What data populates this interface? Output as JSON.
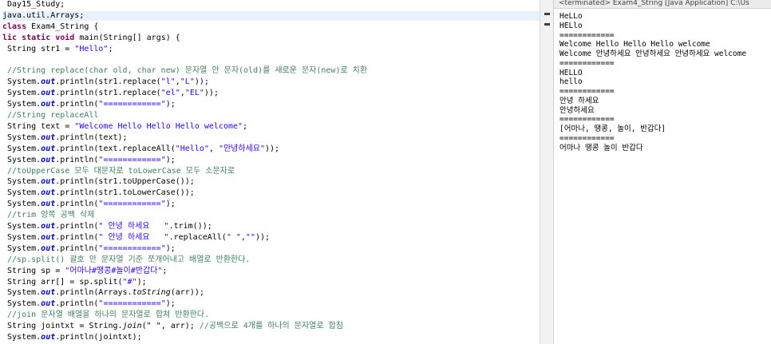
{
  "editor": {
    "lines": [
      {
        "tokens": [
          {
            "t": " Day15_Study;",
            "c": ""
          }
        ]
      },
      {
        "hl": true,
        "tokens": [
          {
            "t": "java.util.Arrays;",
            "c": ""
          }
        ]
      },
      {
        "tokens": [
          {
            "t": "class",
            "c": "k"
          },
          {
            "t": " Exam4_String {",
            "c": ""
          }
        ]
      },
      {
        "tokens": [
          {
            "t": "lic",
            "c": "k"
          },
          {
            "t": " ",
            "c": ""
          },
          {
            "t": "static",
            "c": "k"
          },
          {
            "t": " ",
            "c": ""
          },
          {
            "t": "void",
            "c": "k"
          },
          {
            "t": " main(String[] args) {",
            "c": ""
          }
        ]
      },
      {
        "tokens": [
          {
            "t": " String str1 = ",
            "c": ""
          },
          {
            "t": "\"Hello\"",
            "c": "s"
          },
          {
            "t": ";",
            "c": ""
          }
        ]
      },
      {
        "tokens": [
          {
            "t": "",
            "c": ""
          }
        ]
      },
      {
        "tokens": [
          {
            "t": " //String replace(char old, char new) 문자열 안 문자(old)를 새로운 문자(new)로 치환",
            "c": "c"
          }
        ]
      },
      {
        "tokens": [
          {
            "t": " System.",
            "c": ""
          },
          {
            "t": "out",
            "c": "f"
          },
          {
            "t": ".println(str1.replace(",
            "c": ""
          },
          {
            "t": "\"l\"",
            "c": "s"
          },
          {
            "t": ",",
            "c": ""
          },
          {
            "t": "\"L\"",
            "c": "s"
          },
          {
            "t": "));",
            "c": ""
          }
        ]
      },
      {
        "tokens": [
          {
            "t": " System.",
            "c": ""
          },
          {
            "t": "out",
            "c": "f"
          },
          {
            "t": ".println(str1.replace(",
            "c": ""
          },
          {
            "t": "\"el\"",
            "c": "s"
          },
          {
            "t": ",",
            "c": ""
          },
          {
            "t": "\"EL\"",
            "c": "s"
          },
          {
            "t": "));",
            "c": ""
          }
        ]
      },
      {
        "tokens": [
          {
            "t": " System.",
            "c": ""
          },
          {
            "t": "out",
            "c": "f"
          },
          {
            "t": ".println(",
            "c": ""
          },
          {
            "t": "\"============\"",
            "c": "s"
          },
          {
            "t": ");",
            "c": ""
          }
        ]
      },
      {
        "tokens": [
          {
            "t": " //String replaceAll",
            "c": "c"
          }
        ]
      },
      {
        "tokens": [
          {
            "t": " String text = ",
            "c": ""
          },
          {
            "t": "\"Welcome Hello Hello Hello welcome\"",
            "c": "s"
          },
          {
            "t": ";",
            "c": ""
          }
        ]
      },
      {
        "tokens": [
          {
            "t": " System.",
            "c": ""
          },
          {
            "t": "out",
            "c": "f"
          },
          {
            "t": ".println(text);",
            "c": ""
          }
        ]
      },
      {
        "tokens": [
          {
            "t": " System.",
            "c": ""
          },
          {
            "t": "out",
            "c": "f"
          },
          {
            "t": ".println(text.replaceAll(",
            "c": ""
          },
          {
            "t": "\"Hello\"",
            "c": "s"
          },
          {
            "t": ", ",
            "c": ""
          },
          {
            "t": "\"안녕하세요\"",
            "c": "s"
          },
          {
            "t": "));",
            "c": ""
          }
        ]
      },
      {
        "tokens": [
          {
            "t": " System.",
            "c": ""
          },
          {
            "t": "out",
            "c": "f"
          },
          {
            "t": ".println(",
            "c": ""
          },
          {
            "t": "\"============\"",
            "c": "s"
          },
          {
            "t": ");",
            "c": ""
          }
        ]
      },
      {
        "tokens": [
          {
            "t": " //toUpperCase 모두 대문자로 toLowerCase 모두 소문자로",
            "c": "c"
          }
        ]
      },
      {
        "tokens": [
          {
            "t": " System.",
            "c": ""
          },
          {
            "t": "out",
            "c": "f"
          },
          {
            "t": ".println(str1.toUpperCase());",
            "c": ""
          }
        ]
      },
      {
        "tokens": [
          {
            "t": " System.",
            "c": ""
          },
          {
            "t": "out",
            "c": "f"
          },
          {
            "t": ".println(str1.toLowerCase());",
            "c": ""
          }
        ]
      },
      {
        "tokens": [
          {
            "t": " System.",
            "c": ""
          },
          {
            "t": "out",
            "c": "f"
          },
          {
            "t": ".println(",
            "c": ""
          },
          {
            "t": "\"============\"",
            "c": "s"
          },
          {
            "t": ");",
            "c": ""
          }
        ]
      },
      {
        "tokens": [
          {
            "t": " //trim 양쪽 공백 삭제",
            "c": "c"
          }
        ]
      },
      {
        "tokens": [
          {
            "t": " System.",
            "c": ""
          },
          {
            "t": "out",
            "c": "f"
          },
          {
            "t": ".println(",
            "c": ""
          },
          {
            "t": "\" 안녕 하세요   \"",
            "c": "s"
          },
          {
            "t": ".trim());",
            "c": ""
          }
        ]
      },
      {
        "tokens": [
          {
            "t": " System.",
            "c": ""
          },
          {
            "t": "out",
            "c": "f"
          },
          {
            "t": ".println(",
            "c": ""
          },
          {
            "t": "\" 안녕 하세요   \"",
            "c": "s"
          },
          {
            "t": ".replaceAll(",
            "c": ""
          },
          {
            "t": "\" \"",
            "c": "s"
          },
          {
            "t": ",",
            "c": ""
          },
          {
            "t": "\"\"",
            "c": "s"
          },
          {
            "t": "));",
            "c": ""
          }
        ]
      },
      {
        "tokens": [
          {
            "t": " System.",
            "c": ""
          },
          {
            "t": "out",
            "c": "f"
          },
          {
            "t": ".println(",
            "c": ""
          },
          {
            "t": "\"============\"",
            "c": "s"
          },
          {
            "t": ");",
            "c": ""
          }
        ]
      },
      {
        "tokens": [
          {
            "t": " //sp.split() 괄호 안 문자열 기준 쪼개어내고 배열로 반환한다.",
            "c": "c"
          }
        ]
      },
      {
        "tokens": [
          {
            "t": " String sp = ",
            "c": ""
          },
          {
            "t": "\"어마나#땡콩#놀이#반갑다\"",
            "c": "s"
          },
          {
            "t": ";",
            "c": ""
          }
        ]
      },
      {
        "tokens": [
          {
            "t": " String arr[] = sp.split(",
            "c": ""
          },
          {
            "t": "\"#\"",
            "c": "s"
          },
          {
            "t": ");",
            "c": ""
          }
        ]
      },
      {
        "tokens": [
          {
            "t": " System.",
            "c": ""
          },
          {
            "t": "out",
            "c": "f"
          },
          {
            "t": ".println(Arrays.",
            "c": ""
          },
          {
            "t": "toString",
            "c": "m"
          },
          {
            "t": "(arr));",
            "c": ""
          }
        ]
      },
      {
        "tokens": [
          {
            "t": " System.",
            "c": ""
          },
          {
            "t": "out",
            "c": "f"
          },
          {
            "t": ".println(",
            "c": ""
          },
          {
            "t": "\"============\"",
            "c": "s"
          },
          {
            "t": ");",
            "c": ""
          }
        ]
      },
      {
        "tokens": [
          {
            "t": " //join 문자열 배열을 하나의 문자열로 합쳐 반환한다.",
            "c": "c"
          }
        ]
      },
      {
        "tokens": [
          {
            "t": " String jointxt = String.",
            "c": ""
          },
          {
            "t": "join",
            "c": "m"
          },
          {
            "t": "(\" \", arr); ",
            "c": ""
          },
          {
            "t": "//공백으로 4개를 하나의 문자열로 합침",
            "c": "c"
          }
        ]
      },
      {
        "tokens": [
          {
            "t": " System.",
            "c": ""
          },
          {
            "t": "out",
            "c": "f"
          },
          {
            "t": ".println(jointxt);",
            "c": ""
          }
        ]
      }
    ]
  },
  "console": {
    "header": "<terminated> Exam4_String [Java Application] C:\\Us",
    "lines": [
      "HeLLo",
      "HELlo",
      "============",
      "Welcome Hello Hello Hello welcome",
      "Welcome 안녕하세요 안녕하세요 안녕하세요 welcome",
      "============",
      "HELLO",
      "hello",
      "============",
      "안녕 하세요",
      "안녕하세요",
      "============",
      "[어마나, 땡콩, 놀이, 반갑다]",
      "============",
      "어마나 땡콩 놀이 반갑다"
    ]
  },
  "colors": {
    "keyword": "#7f0055",
    "string": "#2a00ff",
    "comment": "#3f7f5f",
    "field": "#0000c0",
    "current_line": "#e8f2fe"
  }
}
